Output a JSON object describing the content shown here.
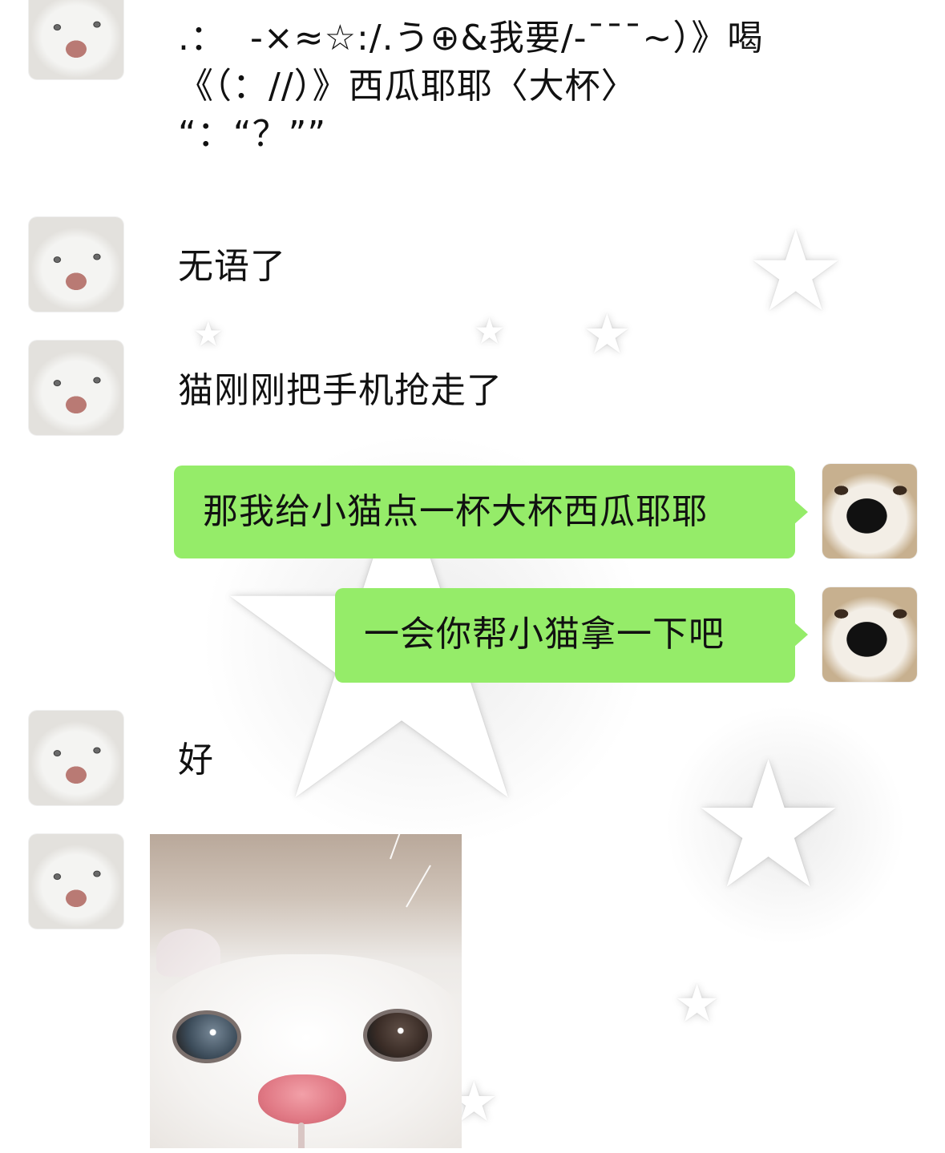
{
  "colors": {
    "background": "#ffffff",
    "bubble_green": "#95ec69",
    "text": "#111111"
  },
  "messages": [
    {
      "side": "left",
      "avatar": "cat-avatar",
      "lines": [
        ".：  -×≈☆:/.う⊕&我要/-ˉˉˉ~）》喝",
        "《（：//）》西瓜耶耶〈大杯〉",
        "“：“？””"
      ]
    },
    {
      "side": "left",
      "avatar": "cat-avatar",
      "text": "无语了"
    },
    {
      "side": "left",
      "avatar": "cat-avatar",
      "text": "猫刚刚把手机抢走了"
    },
    {
      "side": "right",
      "avatar": "dog-avatar",
      "text": "那我给小猫点一杯大杯西瓜耶耶"
    },
    {
      "side": "right",
      "avatar": "dog-avatar",
      "text": "一会你帮小猫拿一下吧"
    },
    {
      "side": "left",
      "avatar": "cat-avatar",
      "text": "好"
    },
    {
      "side": "left",
      "avatar": "cat-avatar",
      "image": "white-kitten-closeup-photo"
    }
  ]
}
